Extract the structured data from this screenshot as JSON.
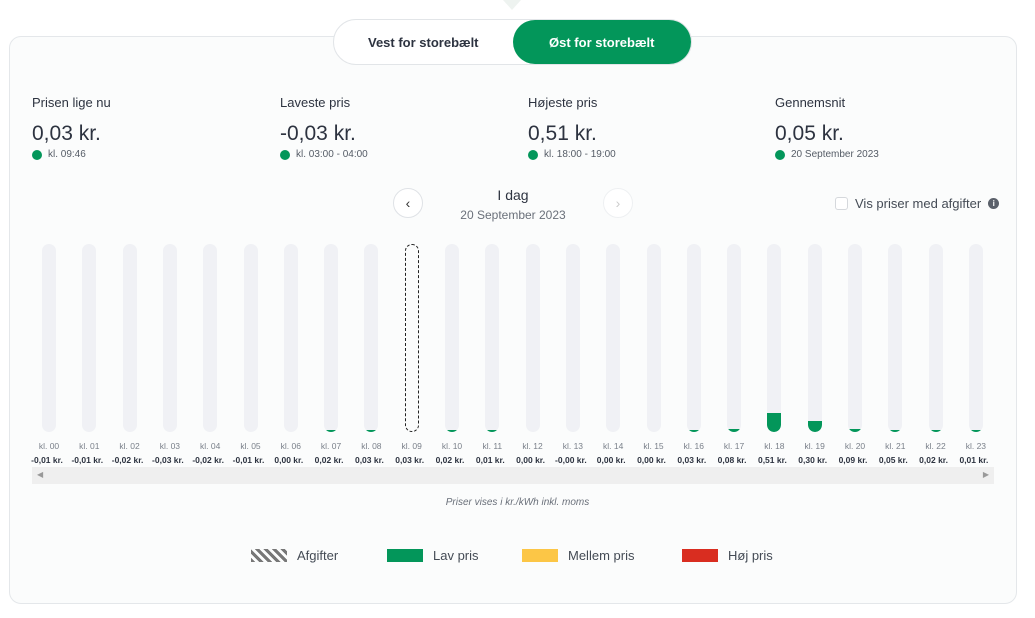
{
  "region_toggle": {
    "west": "Vest for storebælt",
    "east": "Øst for storebælt",
    "active": "east"
  },
  "stats": [
    {
      "label": "Prisen lige nu",
      "value": "0,03 kr.",
      "sub": "kl. 09:46"
    },
    {
      "label": "Laveste pris",
      "value": "-0,03 kr.",
      "sub": "kl. 03:00 - 04:00"
    },
    {
      "label": "Højeste pris",
      "value": "0,51 kr.",
      "sub": "kl. 18:00 - 19:00"
    },
    {
      "label": "Gennemsnit",
      "value": "0,05 kr.",
      "sub": "20 September 2023"
    }
  ],
  "date_nav": {
    "title": "I dag",
    "date": "20 September 2023"
  },
  "fees_checkbox": {
    "label": "Vis priser med afgifter",
    "checked": false
  },
  "chart_data": {
    "type": "bar",
    "current_hour_index": 9,
    "scale_max": 5,
    "hours": [
      "kl. 00",
      "kl. 01",
      "kl. 02",
      "kl. 03",
      "kl. 04",
      "kl. 05",
      "kl. 06",
      "kl. 07",
      "kl. 08",
      "kl. 09",
      "kl. 10",
      "kl. 11",
      "kl. 12",
      "kl. 13",
      "kl. 14",
      "kl. 15",
      "kl. 16",
      "kl. 17",
      "kl. 18",
      "kl. 19",
      "kl. 20",
      "kl. 21",
      "kl. 22",
      "kl. 23"
    ],
    "labels": [
      "-0,01 kr.",
      "-0,01 kr.",
      "-0,02 kr.",
      "-0,03 kr.",
      "-0,02 kr.",
      "-0,01 kr.",
      "0,00 kr.",
      "0,02 kr.",
      "0,03 kr.",
      "0,03 kr.",
      "0,02 kr.",
      "0,01 kr.",
      "0,00 kr.",
      "-0,00 kr.",
      "0,00 kr.",
      "0,00 kr.",
      "0,03 kr.",
      "0,08 kr.",
      "0,51 kr.",
      "0,30 kr.",
      "0,09 kr.",
      "0,05 kr.",
      "0,02 kr.",
      "0,01 kr."
    ],
    "values": [
      -0.01,
      -0.01,
      -0.02,
      -0.03,
      -0.02,
      -0.01,
      0.0,
      0.02,
      0.03,
      0.03,
      0.02,
      0.01,
      0.0,
      -0.0,
      0.0,
      0.0,
      0.03,
      0.08,
      0.51,
      0.3,
      0.09,
      0.05,
      0.02,
      0.01
    ]
  },
  "note": "Priser vises i kr./kWh inkl. moms",
  "legend": [
    {
      "label": "Afgifter",
      "color": "hatch"
    },
    {
      "label": "Lav pris",
      "color": "#03965a"
    },
    {
      "label": "Mellem pris",
      "color": "#fcc646"
    },
    {
      "label": "Høj pris",
      "color": "#d92d20"
    }
  ]
}
